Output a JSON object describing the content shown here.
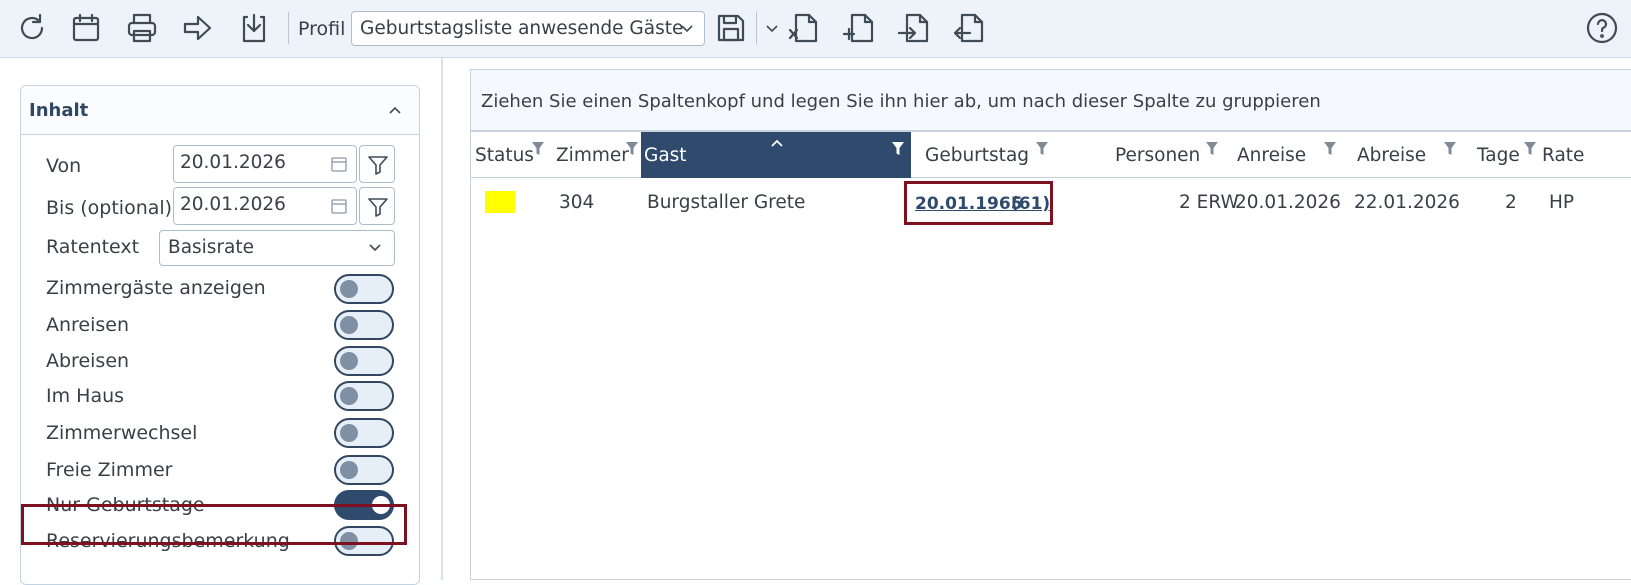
{
  "toolbar": {
    "icons": [
      "refresh-icon",
      "calendar-icon",
      "print-icon",
      "forward-icon",
      "download-icon",
      "save-icon",
      "chevron-down-icon",
      "export-excel-icon",
      "new-document-icon",
      "import-icon",
      "export-icon",
      "help-icon"
    ],
    "profil_label": "Profil",
    "profil_value": "Geburtstagsliste anwesende Gäste"
  },
  "sidebar": {
    "section_title": "Inhalt",
    "von_label": "Von",
    "von_value": "20.01.2026",
    "bis_label": "Bis (optional)",
    "bis_value": "20.01.2026",
    "ratentext_label": "Ratentext",
    "ratentext_value": "Basisrate",
    "toggles": [
      {
        "label": "Zimmergäste anzeigen",
        "on": false
      },
      {
        "label": "Anreisen",
        "on": false
      },
      {
        "label": "Abreisen",
        "on": false
      },
      {
        "label": "Im Haus",
        "on": false
      },
      {
        "label": "Zimmerwechsel",
        "on": false
      },
      {
        "label": "Freie Zimmer",
        "on": false
      },
      {
        "label": "Nur Geburtstage",
        "on": true
      },
      {
        "label": "Reservierungsbemerkung",
        "on": false
      }
    ]
  },
  "grid": {
    "group_hint": "Ziehen Sie einen Spaltenkopf und legen Sie ihn hier ab, um nach dieser Spalte zu gruppieren",
    "columns": [
      "Status",
      "Zimmer",
      "Gast",
      "Geburtstag",
      "Personen",
      "Anreise",
      "Abreise",
      "Tage",
      "Rate"
    ],
    "sorted_column": "Gast",
    "rows": [
      {
        "status_color": "#ffff00",
        "zimmer": "304",
        "gast": "Burgstaller Grete",
        "geburtstag": "20.01.1965",
        "alter": "(61)",
        "personen": "2 ERW",
        "anreise": "20.01.2026",
        "abreise": "22.01.2026",
        "tage": "2",
        "rate": "HP"
      }
    ]
  }
}
